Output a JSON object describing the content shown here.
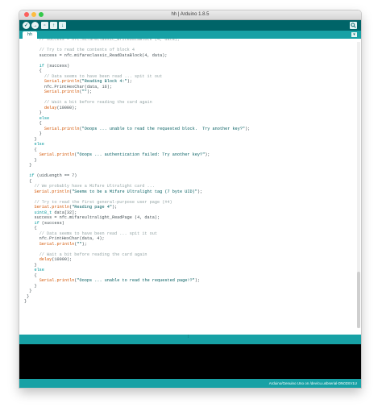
{
  "window": {
    "title": "hh | Arduino 1.8.5"
  },
  "toolbar": {
    "buttons": [
      {
        "name": "verify",
        "icon": "check-icon",
        "glyph": "✓"
      },
      {
        "name": "upload",
        "icon": "arrow-right-icon",
        "glyph": "→"
      },
      {
        "name": "new",
        "icon": "new-file-icon",
        "glyph": "▫"
      },
      {
        "name": "open",
        "icon": "open-icon",
        "glyph": "↑"
      },
      {
        "name": "save",
        "icon": "save-icon",
        "glyph": "↓"
      }
    ],
    "serial_monitor_icon": "magnifier-icon"
  },
  "tabs": [
    {
      "label": "hh",
      "active": true
    }
  ],
  "editor": {
    "lines": [
      "      // success = nfc.mifareclassic_WriteDataBlock (4, data);",
      "",
      "      // Try to read the contents of block 4",
      "      success = nfc.mifareclassic_ReadDataBlock(4, data);",
      "",
      "      if (success)",
      "      {",
      "        // Data seems to have been read ... spit it out",
      "        Serial.println(\"Reading Block 4:\");",
      "        nfc.PrintHexChar(data, 16);",
      "        Serial.println(\"\");",
      "",
      "        // Wait a bit before reading the card again",
      "        delay(10000);",
      "      }",
      "      else",
      "      {",
      "        Serial.println(\"Ooops ... unable to read the requested block.  Try another key?\");",
      "      }",
      "    }",
      "    else",
      "    {",
      "      Serial.println(\"Ooops ... authentication failed: Try another key?\");",
      "    }",
      "  }",
      "",
      "  if (uidLength == 7)",
      "  {",
      "    // We probably have a Mifare Ultralight card ...",
      "    Serial.println(\"Seems to be a Mifare Ultralight tag (7 byte UID)\");",
      "",
      "    // Try to read the first general-purpose user page (#4)",
      "    Serial.println(\"Reading page 4\");",
      "    uint8_t data[32];",
      "    success = nfc.mifareultralight_ReadPage (4, data);",
      "    if (success)",
      "    {",
      "      // Data seems to have been read ... spit it out",
      "      nfc.PrintHexChar(data, 4);",
      "      Serial.println(\"\");",
      "",
      "      // Wait a bit before reading the card again",
      "      delay(10000);",
      "    }",
      "    else",
      "    {",
      "      Serial.println(\"Ooops ... unable to read the requested page!?\");",
      "    }",
      "  }",
      " }",
      "}",
      "",
      "",
      "",
      "",
      "",
      ""
    ]
  },
  "status": {
    "board": "Arduino/Genuino Uno on /dev/cu.usbserial-DN03SV1U"
  },
  "colors": {
    "toolbar": "#006468",
    "tabbar": "#17a1a5",
    "console": "#000000",
    "keyword": "#00979c",
    "string": "#005c5f",
    "comment": "#95a5a6",
    "function": "#d35400"
  }
}
